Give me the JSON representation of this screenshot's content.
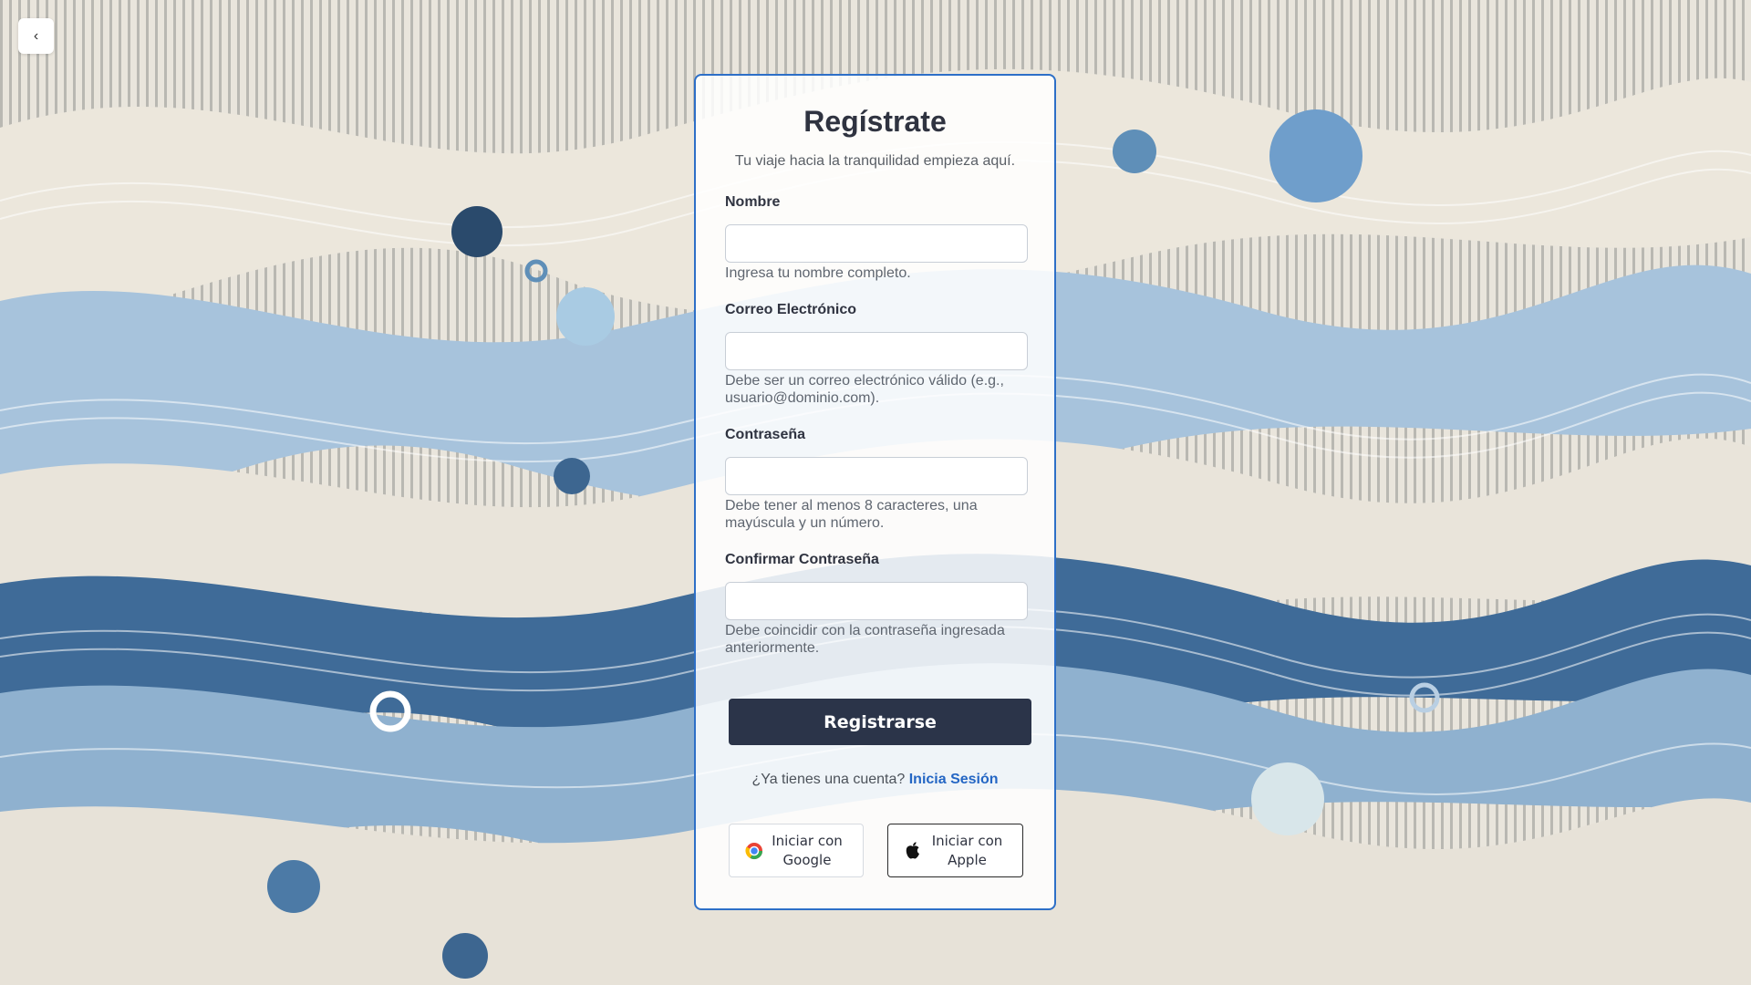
{
  "nav": {
    "back_icon": "‹"
  },
  "form": {
    "title": "Regístrate",
    "subtitle": "Tu viaje hacia la tranquilidad empieza aquí.",
    "fields": [
      {
        "label": "Nombre",
        "value": "",
        "hint": "Ingresa tu nombre completo."
      },
      {
        "label": "Correo Electrónico",
        "value": "",
        "hint": "Debe ser un correo electrónico válido (e.g., usuario@dominio.com)."
      },
      {
        "label": "Contraseña",
        "value": "",
        "hint": "Debe tener al menos 8 caracteres, una mayúscula y un número."
      },
      {
        "label": "Confirmar Contraseña",
        "value": "",
        "hint": "Debe coincidir con la contraseña ingresada anteriormente."
      }
    ],
    "submit_label": "Registrarse",
    "login_prompt": "¿Ya tienes una cuenta?",
    "login_link": "Inicia Sesión",
    "social": {
      "google_label": "Iniciar con Google",
      "apple_label": "Iniciar con Apple"
    }
  },
  "colors": {
    "accent": "#2466c4",
    "card_border": "#2d6fc7",
    "submit_bg": "#2b3449"
  }
}
